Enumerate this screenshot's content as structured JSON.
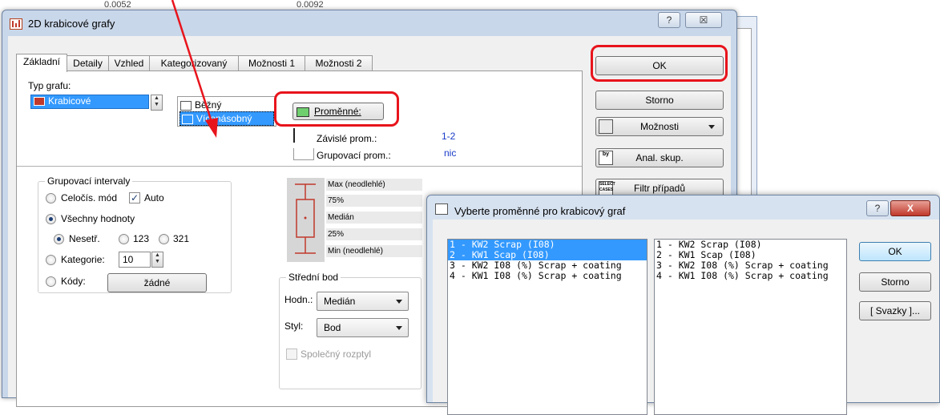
{
  "background": {
    "col1": "0.0052",
    "col2": "0.0092"
  },
  "main_window": {
    "title": "2D krabicové grafy",
    "help_btn": "?",
    "close_btn": "☒",
    "tabs": [
      "Základní",
      "Detaily",
      "Vzhled",
      "Kategorizovaný",
      "Možnosti 1",
      "Možnosti 2"
    ],
    "graph_type_label": "Typ grafu:",
    "graph_type_value": "Krabicové",
    "style_normal": "Běžný",
    "style_multiple": "Vícenásobný",
    "variables_btn": "Proměnné:",
    "dependent_label": "Závislé prom.:",
    "dependent_value": "1-2",
    "grouping_label": "Grupovací prom.:",
    "grouping_value": "nic",
    "group_intervals": {
      "title": "Grupovací intervaly",
      "integer_mode": "Celočís. mód",
      "auto": "Auto",
      "all_values": "Všechny hodnoty",
      "unsorted": "Nesetř.",
      "asc": "123",
      "desc": "321",
      "categories": "Kategorie:",
      "categories_value": "10",
      "codes": "Kódy:",
      "codes_btn": "žádné"
    },
    "legend": {
      "max": "Max (neodlehlé)",
      "p75": "75%",
      "median": "Medián",
      "p25": "25%",
      "min": "Min (neodlehlé)"
    },
    "midpoint": {
      "title": "Střední bod",
      "value_label": "Hodn.:",
      "value": "Medián",
      "style_label": "Styl:",
      "style": "Bod",
      "shared_spread": "Společný rozptyl"
    },
    "side_buttons": {
      "ok": "OK",
      "cancel": "Storno",
      "options": "Možnosti",
      "anal_group": "Anal. skup.",
      "case_filter": "Filtr případů",
      "select_cases_icon": "SELECT CASES",
      "by_icon": "by"
    }
  },
  "var_dialog": {
    "title": "Vyberte proměnné pro krabicový graf",
    "help_btn": "?",
    "close_btn": "X",
    "left_list": [
      "1 - KW2 Scrap (I08)",
      "2 - KW1 Scap (I08)",
      "3 - KW2 I08 (%) Scrap + coating",
      "4 - KW1 I08 (%) Scrap + coating"
    ],
    "right_list": [
      "1 - KW2 Scrap (I08)",
      "2 - KW1 Scap (I08)",
      "3 - KW2 I08 (%) Scrap + coating",
      "4 - KW1 I08 (%) Scrap + coating"
    ],
    "ok": "OK",
    "cancel": "Storno",
    "bundles": "[ Svazky ]..."
  },
  "colors": {
    "highlight": "#3399ff",
    "annotation_red": "#e8141c"
  }
}
